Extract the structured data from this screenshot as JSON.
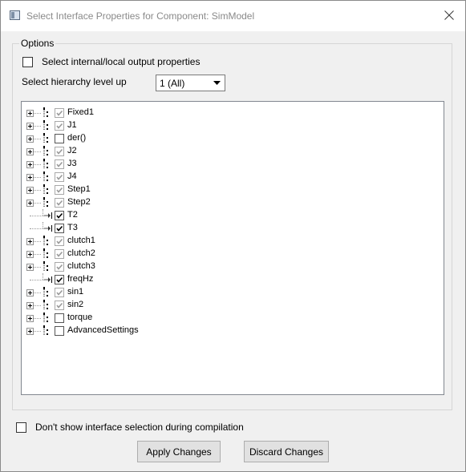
{
  "window": {
    "title": "Select Interface Properties for Component: SimModel"
  },
  "options": {
    "legend": "Options",
    "internal_output_label": "Select internal/local output properties",
    "hierarchy_label": "Select hierarchy level up",
    "hierarchy_value": "1 (All)"
  },
  "tree": {
    "items": [
      {
        "label": "Fixed1",
        "expandable": true,
        "checked": true,
        "dimmed": true
      },
      {
        "label": "J1",
        "expandable": true,
        "checked": true,
        "dimmed": true
      },
      {
        "label": "der()",
        "expandable": true,
        "checked": false,
        "dimmed": false
      },
      {
        "label": "J2",
        "expandable": true,
        "checked": true,
        "dimmed": true
      },
      {
        "label": "J3",
        "expandable": true,
        "checked": true,
        "dimmed": true
      },
      {
        "label": "J4",
        "expandable": true,
        "checked": true,
        "dimmed": true
      },
      {
        "label": "Step1",
        "expandable": true,
        "checked": true,
        "dimmed": true
      },
      {
        "label": "Step2",
        "expandable": true,
        "checked": true,
        "dimmed": true
      },
      {
        "label": "T2",
        "expandable": false,
        "checked": true,
        "dimmed": false
      },
      {
        "label": "T3",
        "expandable": false,
        "checked": true,
        "dimmed": false
      },
      {
        "label": "clutch1",
        "expandable": true,
        "checked": true,
        "dimmed": true
      },
      {
        "label": "clutch2",
        "expandable": true,
        "checked": true,
        "dimmed": true
      },
      {
        "label": "clutch3",
        "expandable": true,
        "checked": true,
        "dimmed": true
      },
      {
        "label": "freqHz",
        "expandable": false,
        "checked": true,
        "dimmed": false
      },
      {
        "label": "sin1",
        "expandable": true,
        "checked": true,
        "dimmed": true
      },
      {
        "label": "sin2",
        "expandable": true,
        "checked": true,
        "dimmed": true
      },
      {
        "label": "torque",
        "expandable": true,
        "checked": false,
        "dimmed": false
      },
      {
        "label": "AdvancedSettings",
        "expandable": true,
        "checked": false,
        "dimmed": false
      }
    ]
  },
  "footer": {
    "dont_show_label": "Don't show interface selection during compilation",
    "apply_label": "Apply Changes",
    "discard_label": "Discard Changes"
  }
}
